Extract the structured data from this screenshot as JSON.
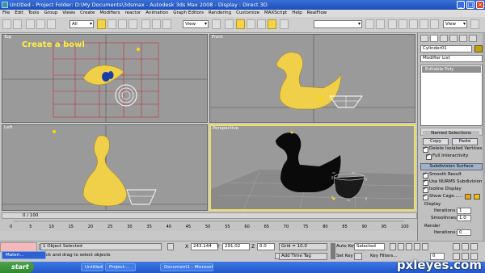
{
  "window": {
    "title": "Untitled    - Project Folder: D:\\My Documents\\3dsmax    - Autodesk 3ds Max 2008    - Display : Direct 3D"
  },
  "menu": [
    "File",
    "Edit",
    "Tools",
    "Group",
    "Views",
    "Create",
    "Modifiers",
    "reactor",
    "Animation",
    "Graph Editors",
    "Rendering",
    "Customize",
    "MAXScript",
    "Help",
    "RealFlow"
  ],
  "toolbar": {
    "selection_filter": "All",
    "reference_coord": "View",
    "named_selection": "View"
  },
  "viewports": {
    "top": {
      "label": "Top",
      "caption": "Create a bowl"
    },
    "front": {
      "label": "Front"
    },
    "left": {
      "label": "Left"
    },
    "perspective": {
      "label": "Perspective"
    }
  },
  "command_panel": {
    "object_name": "Cylinder01",
    "modifier_list": "Modifier List",
    "stack_item": "Editable Poly",
    "named_selections_title": "Named Selections",
    "copy_label": "Copy",
    "paste_label": "Paste",
    "delete_isolated": "Delete Isolated Vertices",
    "full_interactivity": "Full Interactivity",
    "subdivision_title": "Subdivision Surface",
    "smooth_result": "Smooth Result",
    "use_nurms": "Use NURMS Subdivision",
    "isoline_display": "Isoline Display",
    "show_cage": "Show Cage......",
    "display_title": "Display",
    "iterations_label": "Iterations:",
    "iterations_value": "1",
    "smoothness_label": "Smoothness:",
    "smoothness_value": "1.0",
    "render_title": "Render",
    "render_iterations_value": "0"
  },
  "timeline": {
    "frame": "0 / 100",
    "ticks": [
      "0",
      "5",
      "10",
      "15",
      "20",
      "25",
      "30",
      "35",
      "40",
      "45",
      "50",
      "55",
      "60",
      "65",
      "70",
      "75",
      "80",
      "85",
      "90",
      "95",
      "100"
    ]
  },
  "status": {
    "selection": "1 Object Selected",
    "prompt": "Click and drag to select objects",
    "x_label": "X",
    "x_value": "243.144",
    "y_label": "Y",
    "y_value": "291.02",
    "z_label": "Z",
    "z_value": "0.0",
    "grid": "Grid = 10.0",
    "add_time_tag": "Add Time Tag",
    "auto_key": "Auto Key",
    "set_key": "Set Key",
    "selected": "Selected",
    "key_filters": "Key Filters...",
    "frame_value": "0"
  },
  "taskbar": {
    "start": "start",
    "tasks": [
      "Materi...",
      "Untitled - ...",
      "Project...",
      "Document1 - Microsof..."
    ]
  },
  "watermark": "pxleyes.com",
  "colors": {
    "duck_yellow": "#f0d048",
    "grid_red": "#c0303a",
    "active_border": "#f0e060"
  }
}
